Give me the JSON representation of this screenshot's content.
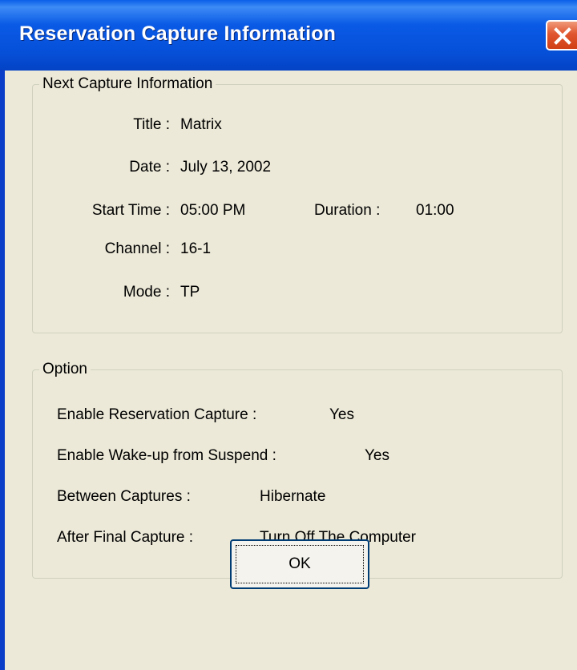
{
  "window": {
    "title": "Reservation Capture Information"
  },
  "next_capture": {
    "legend": "Next Capture Information",
    "title_label": "Title :",
    "title_value": "Matrix",
    "date_label": "Date :",
    "date_value": "July 13, 2002",
    "start_time_label": "Start Time :",
    "start_time_value": "05:00 PM",
    "duration_label": "Duration :",
    "duration_value": "01:00",
    "channel_label": "Channel :",
    "channel_value": "16-1",
    "mode_label": "Mode :",
    "mode_value": "TP"
  },
  "option": {
    "legend": "Option",
    "enable_reservation_label": "Enable Reservation Capture :",
    "enable_reservation_value": "Yes",
    "enable_wakeup_label": "Enable Wake-up from Suspend :",
    "enable_wakeup_value": "Yes",
    "between_captures_label": "Between Captures :",
    "between_captures_value": "Hibernate",
    "after_final_label": "After Final Capture :",
    "after_final_value": "Turn Off The Computer"
  },
  "buttons": {
    "ok_label": "OK"
  },
  "colors": {
    "titlebar": "#0a5ae6",
    "close_button": "#e0562e",
    "dialog_background": "#ece9d8"
  }
}
